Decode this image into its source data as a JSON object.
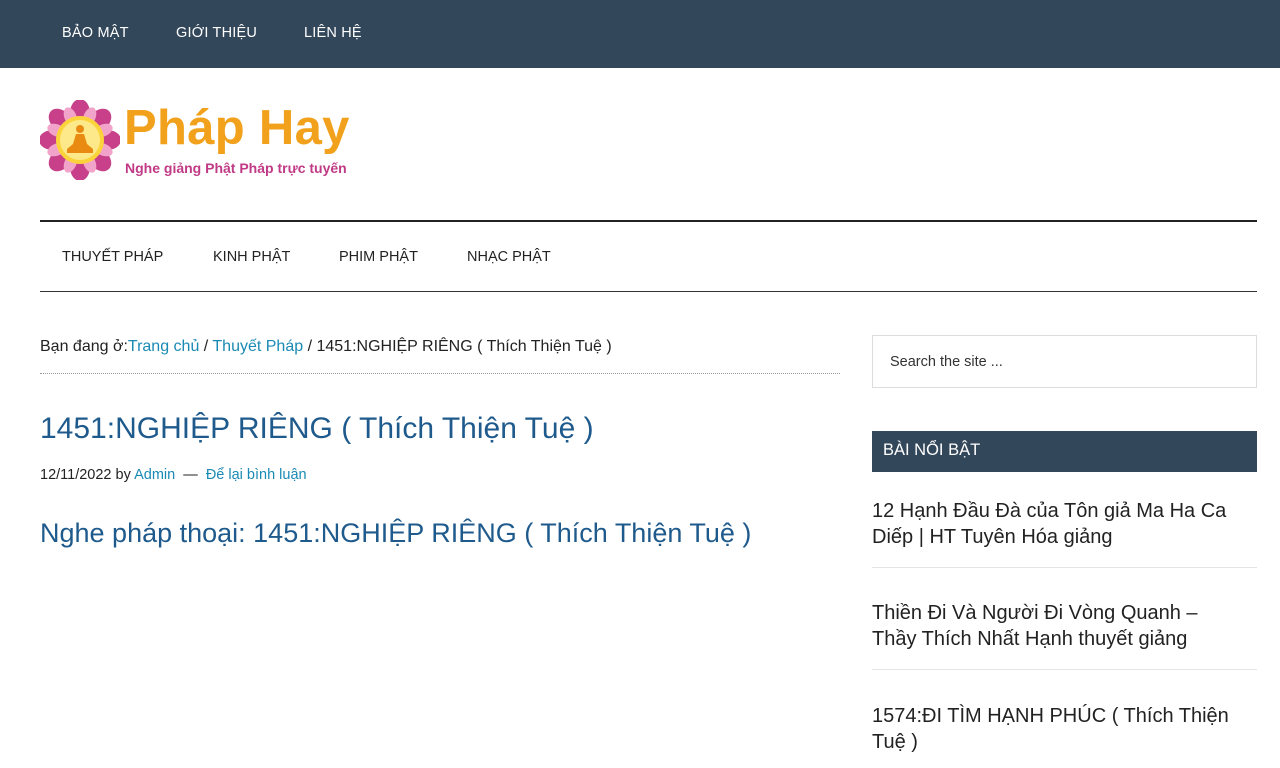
{
  "top_nav": [
    "BẢO MẬT",
    "GIỚI THIỆU",
    "LIÊN HỆ"
  ],
  "logo": {
    "title": "Pháp Hay",
    "tagline": "Nghe giảng Phật Pháp trực tuyến",
    "icon": "buddha-lotus-icon"
  },
  "main_nav": [
    "THUYẾT PHÁP",
    "KINH PHẬT",
    "PHIM PHẬT",
    "NHẠC PHẬT"
  ],
  "breadcrumb": {
    "prefix": "Bạn đang ở:",
    "home": "Trang chủ",
    "sep1": " / ",
    "category": "Thuyết Pháp",
    "sep2": " / ",
    "current": "1451:NGHIỆP RIÊNG ( Thích Thiện Tuệ )"
  },
  "post": {
    "title": "1451:NGHIỆP RIÊNG ( Thích Thiện Tuệ )",
    "date": "12/11/2022",
    "by": "by",
    "author": "Admin",
    "dash": "—",
    "comment_link": "Để lại bình luận",
    "subheading": "Nghe pháp thoại: 1451:NGHIỆP RIÊNG ( Thích Thiện Tuệ )"
  },
  "sidebar": {
    "search_placeholder": "Search the site ...",
    "widget_title": "BÀI NỔI BẬT",
    "featured": [
      {
        "line1": "12 Hạnh Đầu Đà của Tôn giả Ma Ha Ca",
        "line2": "Diếp | HT Tuyên Hóa giảng"
      },
      {
        "line1": "Thiền Đi Và Người Đi Vòng Quanh –",
        "line2": "Thầy Thích Nhất Hạnh thuyết giảng"
      },
      {
        "line1": "1574:ĐI TÌM HẠNH PHÚC ( Thích Thiện",
        "line2": "Tuệ )"
      }
    ]
  },
  "colors": {
    "topbar": "#33475b",
    "logo_title": "#f1a11b",
    "logo_tagline": "#c03a86",
    "link": "#1a8ab4",
    "title_blue": "#1e5a8c"
  }
}
